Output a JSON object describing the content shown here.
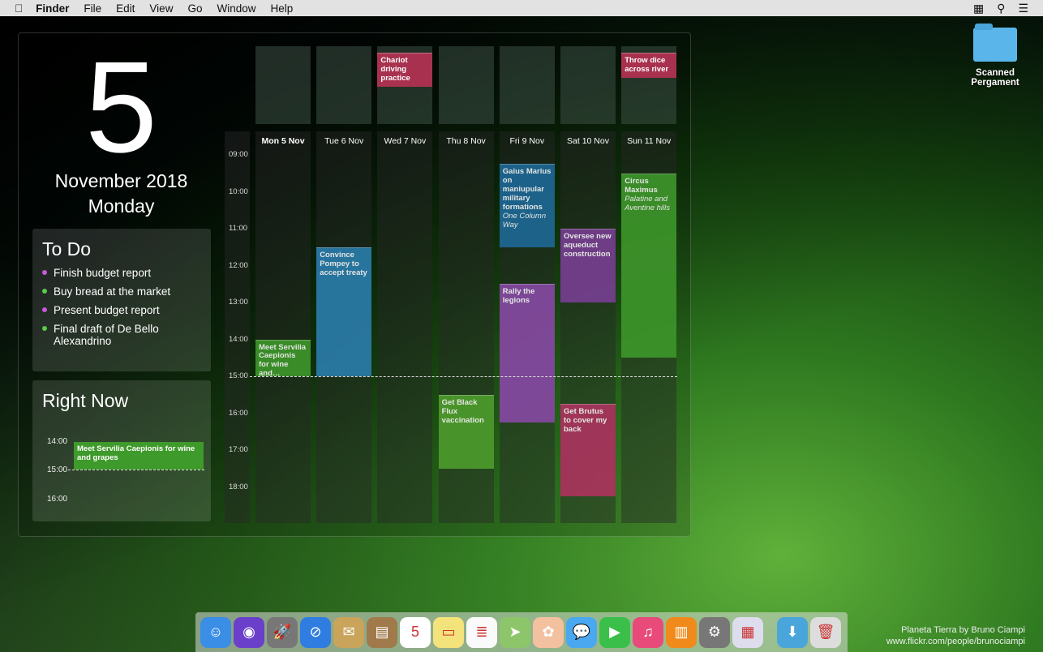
{
  "menubar": {
    "apple": "",
    "app": "Finder",
    "items": [
      "File",
      "Edit",
      "View",
      "Go",
      "Window",
      "Help"
    ]
  },
  "date": {
    "day": "5",
    "month_year": "November 2018",
    "weekday": "Monday"
  },
  "todo": {
    "title": "To Do",
    "items": [
      {
        "text": "Finish budget report",
        "color": "#c35bd6"
      },
      {
        "text": "Buy bread at the market",
        "color": "#5bc94a"
      },
      {
        "text": "Present budget report",
        "color": "#c35bd6"
      },
      {
        "text": "Final draft of De Bello Alexandrino",
        "color": "#5bc94a"
      }
    ]
  },
  "right_now": {
    "title": "Right Now",
    "times": [
      "14:00",
      "15:00",
      "16:00"
    ],
    "event": "Meet Servilia Caepionis for wine and grapes"
  },
  "calendar": {
    "hours": [
      "09:00",
      "10:00",
      "11:00",
      "12:00",
      "13:00",
      "14:00",
      "15:00",
      "16:00",
      "17:00",
      "18:00"
    ],
    "now": 15,
    "days": [
      {
        "label": "Mon 5 Nov",
        "today": true,
        "allday": [],
        "events": [
          {
            "title": "Meet Servilia Caepionis for wine and…",
            "start": 14,
            "end": 15,
            "color": "#3e9a2a"
          }
        ]
      },
      {
        "label": "Tue 6 Nov",
        "allday": [],
        "events": [
          {
            "title": "Convince Pompey to accept treaty",
            "start": 11.5,
            "end": 15,
            "color": "#2a7fb0"
          }
        ]
      },
      {
        "label": "Wed 7 Nov",
        "allday": [
          "Chariot driving practice"
        ],
        "events": []
      },
      {
        "label": "Thu 8 Nov",
        "allday": [],
        "events": [
          {
            "title": "Get Black Flux vaccination",
            "start": 15.5,
            "end": 17.5,
            "color": "#4fa02c"
          }
        ]
      },
      {
        "label": "Fri 9 Nov",
        "allday": [],
        "events": [
          {
            "title": "Gaius Marius on maniupular military formations",
            "location": "One Column Way",
            "start": 9.25,
            "end": 11.5,
            "color": "#1d6a99"
          },
          {
            "title": "Rally the legions",
            "start": 12.5,
            "end": 16.25,
            "color": "#8a4aa8"
          }
        ]
      },
      {
        "label": "Sat 10 Nov",
        "allday": [],
        "events": [
          {
            "title": "Oversee new aqueduct construction",
            "start": 11,
            "end": 13,
            "color": "#7a3f95"
          },
          {
            "title": "Get Brutus to cover my back",
            "start": 15.75,
            "end": 18.25,
            "color": "#b03360"
          }
        ]
      },
      {
        "label": "Sun 11 Nov",
        "allday": [
          "Throw dice across river"
        ],
        "events": [
          {
            "title": "Circus Maximus",
            "location": "Palatine and Aventine hills",
            "start": 9.5,
            "end": 14.5,
            "color": "#3e9a2a"
          }
        ]
      }
    ]
  },
  "desktop": {
    "folder": "Scanned Pergament"
  },
  "dock": [
    "Finder",
    "Siri",
    "Launchpad",
    "Safari",
    "Mail",
    "Contacts",
    "Calendar",
    "Notes",
    "Reminders",
    "Maps",
    "Photos",
    "Messages",
    "FaceTime",
    "iTunes",
    "iBooks",
    "System Preferences",
    "Preview",
    "Downloads",
    "Trash"
  ],
  "credit": {
    "line1": "Planeta Tierra by Bruno Ciampi",
    "line2": "www.flickr.com/people/brunociampi"
  }
}
